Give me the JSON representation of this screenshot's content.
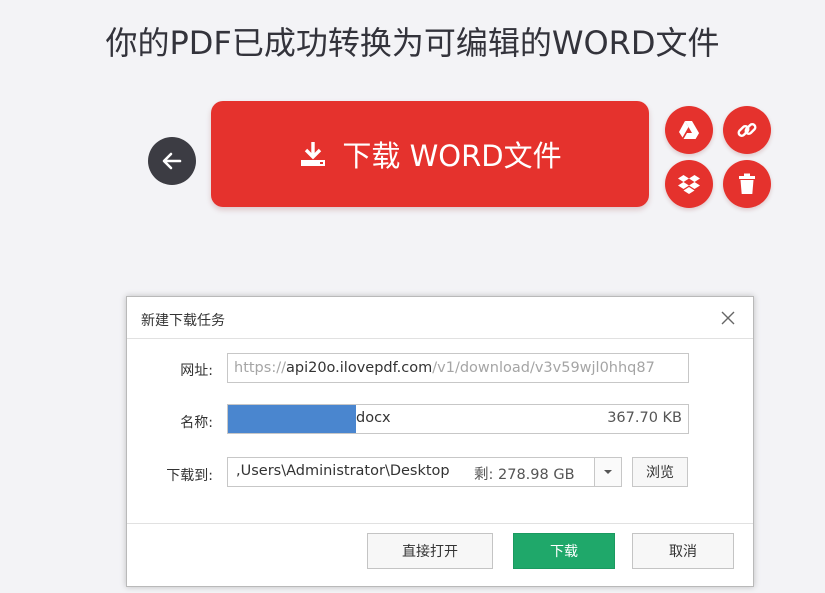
{
  "page": {
    "headline": "你的PDF已成功转换为可编辑的WORD文件",
    "download_button_label": "下载 WORD文件",
    "icons": {
      "back": "arrow-left-icon",
      "download": "download-icon",
      "google_drive": "google-drive-icon",
      "link": "link-icon",
      "dropbox": "dropbox-icon",
      "delete": "trash-icon"
    },
    "colors": {
      "primary": "#e5322d",
      "dark": "#3c3c43",
      "confirm": "#1fa86a"
    }
  },
  "dialog": {
    "title": "新建下载任务",
    "url_label": "网址:",
    "url_prefix": "https://",
    "url_host": "api20o.ilovepdf.com",
    "url_path": "/v1/download/v3v59wjl0hhq87",
    "name_label": "名称:",
    "name_ext": "docx",
    "name_size": "367.70 KB",
    "path_label": "下载到:",
    "path_value": ",Users\\Administrator\\Desktop",
    "free_space": "剩: 278.98 GB",
    "browse_label": "浏览",
    "open_label": "直接打开",
    "download_label": "下载",
    "cancel_label": "取消"
  }
}
